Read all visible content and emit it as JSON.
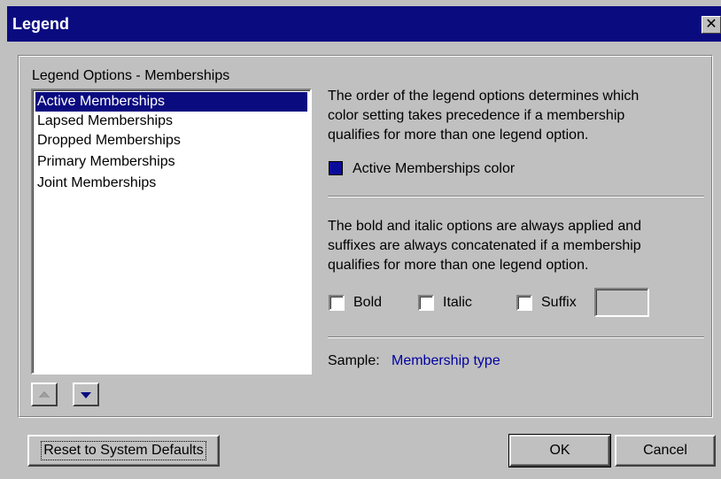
{
  "window": {
    "title": "Legend",
    "close_glyph": "✕"
  },
  "group": {
    "label": "Legend Options - Memberships"
  },
  "list": {
    "items": [
      {
        "label": "Active Memberships",
        "selected": true
      },
      {
        "label": "Lapsed Memberships",
        "selected": false
      },
      {
        "label": "Dropped Memberships",
        "selected": false
      },
      {
        "label": "Primary Memberships",
        "selected": false
      },
      {
        "label": "Joint Memberships",
        "selected": false
      }
    ]
  },
  "order_description": "The order of the legend options determines which\ncolor setting takes precedence if a membership\nqualifies for more than one legend option.",
  "color": {
    "label": "Active Memberships color",
    "value": "#0b0b9a"
  },
  "format_description": "The bold and italic options are always applied and\nsuffixes are always concatenated if a membership\nqualifies for more than one legend option.",
  "options": {
    "bold_label": "Bold",
    "italic_label": "Italic",
    "suffix_label": "Suffix",
    "suffix_value": ""
  },
  "sample": {
    "label": "Sample:",
    "value": "Membership type"
  },
  "buttons": {
    "reset": "Reset to System Defaults",
    "ok": "OK",
    "cancel": "Cancel"
  }
}
